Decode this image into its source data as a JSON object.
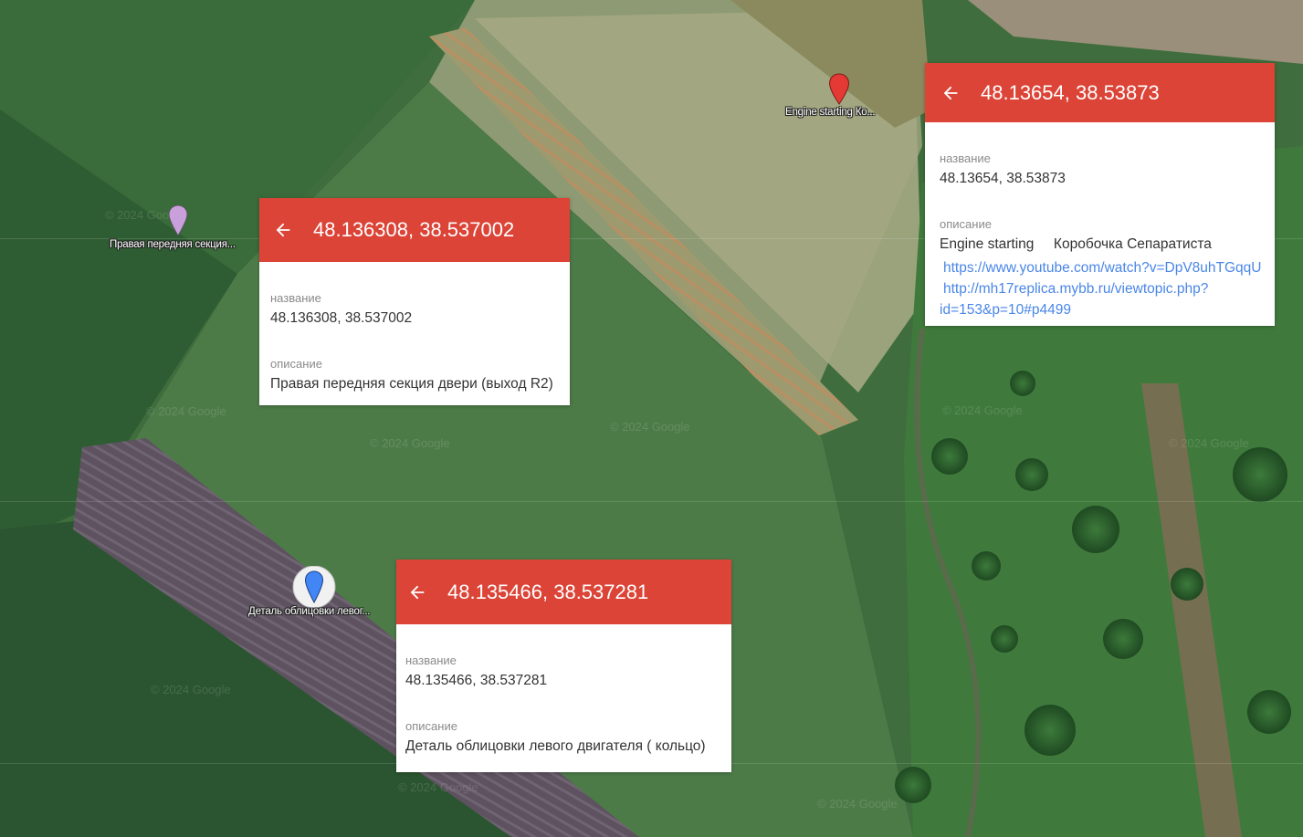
{
  "map": {
    "watermark": "© 2024 Google",
    "markers": [
      {
        "name": "marker-right-front-door",
        "label": "Правая передняя секция...",
        "color": "#c9a0dc"
      },
      {
        "name": "marker-engine-starting",
        "label": "Engine starting     Ко...",
        "color": "#e53935"
      },
      {
        "name": "marker-engine-cowling",
        "label": "Деталь облицовки левог...",
        "color": "#4285f4"
      }
    ]
  },
  "cards": {
    "card1": {
      "title": "48.136308, 38.537002",
      "name_label": "название",
      "name_value": "48.136308, 38.537002",
      "desc_label": "описание",
      "desc_value": "Правая передняя секция двери (выход R2)"
    },
    "card2": {
      "title": "48.13654, 38.53873",
      "name_label": "название",
      "name_value": "48.13654, 38.53873",
      "desc_label": "описание",
      "desc_value": "Engine starting     Коробочка Сепаратиста",
      "link1": "https://www.youtube.com/watch?v=DpV8uhTGqqU",
      "link2_line1": "http://mh17replica.mybb.ru/viewtopic.php?",
      "link2_line2": "id=153&p=10#p4499"
    },
    "card3": {
      "title": "48.135466, 38.537281",
      "name_label": "название",
      "name_value": "48.135466, 38.537281",
      "desc_label": "описание",
      "desc_value": "Деталь облицовки левого двигателя ( кольцо)"
    }
  },
  "colors": {
    "header": "#db4437",
    "link": "#4a86e8"
  }
}
